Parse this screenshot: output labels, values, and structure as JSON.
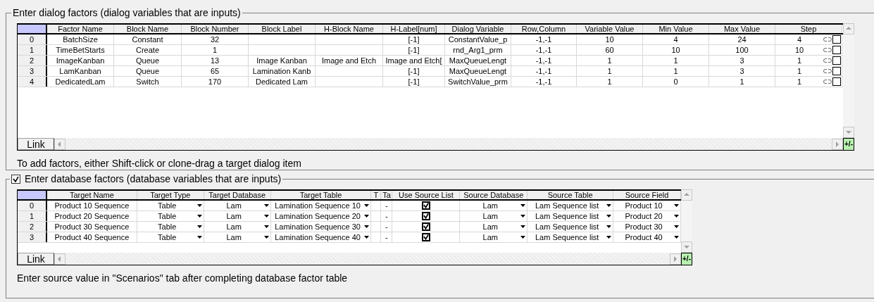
{
  "dialog_factors": {
    "title": "Enter dialog factors (dialog variables that are inputs)",
    "columns": [
      "Factor Name",
      "Block Name",
      "Block Number",
      "Block Label",
      "H-Block Name",
      "H-Label[num]",
      "Dialog Variable",
      "Row,Column",
      "Variable Value",
      "Min Value",
      "Max Value",
      "Step"
    ],
    "rows": [
      {
        "index": "0",
        "cells": [
          "BatchSize",
          "Constant",
          "32",
          "",
          "",
          "[-1]",
          "ConstantValue_p",
          "-1,-1",
          "10",
          "4",
          "24",
          "4"
        ],
        "checked": false
      },
      {
        "index": "1",
        "cells": [
          "TimeBetStarts",
          "Create",
          "1",
          "",
          "",
          "[-1]",
          "rnd_Arg1_prm",
          "-1,-1",
          "60",
          "10",
          "100",
          "10"
        ],
        "checked": false
      },
      {
        "index": "2",
        "cells": [
          "ImageKanban",
          "Queue",
          "13",
          "Image Kanban",
          "Image and Etch",
          "Image and Etch[",
          "MaxQueueLengt",
          "-1,-1",
          "1",
          "1",
          "3",
          "1"
        ],
        "checked": false
      },
      {
        "index": "3",
        "cells": [
          "LamKanban",
          "Queue",
          "65",
          "Lamination Kanb",
          "",
          "[-1]",
          "MaxQueueLengt",
          "-1,-1",
          "1",
          "1",
          "3",
          "1"
        ],
        "checked": false
      },
      {
        "index": "4",
        "cells": [
          "DedicatedLam",
          "Switch",
          "170",
          "Dedicated Lam",
          "",
          "[-1]",
          "SwitchValue_prm",
          "-1,-1",
          "1",
          "0",
          "1",
          "1"
        ],
        "checked": false
      }
    ],
    "link_button": "Link",
    "add_remove_button": "+/-",
    "hint": "To add factors, either Shift-click or clone-drag a target dialog item"
  },
  "database_factors": {
    "title": "Enter database factors (database variables that are inputs)",
    "enabled": true,
    "columns": [
      {
        "label": "Target Name",
        "kind": "text"
      },
      {
        "label": "Target Type",
        "kind": "dropdown"
      },
      {
        "label": "Target Database",
        "kind": "dropdown"
      },
      {
        "label": "Target Table",
        "kind": "dropdown"
      },
      {
        "label": "T",
        "kind": "text"
      },
      {
        "label": "Ta",
        "kind": "text"
      },
      {
        "label": "Use Source List",
        "kind": "checkbox"
      },
      {
        "label": "Source Database",
        "kind": "dropdown"
      },
      {
        "label": "Source Table",
        "kind": "dropdown"
      },
      {
        "label": "Source Field",
        "kind": "dropdown"
      }
    ],
    "rows": [
      {
        "index": "0",
        "cells": [
          "Product 10 Sequence",
          "Table",
          "Lam",
          "Lamination Sequence 10",
          "",
          "-",
          true,
          "Lam",
          "Lam Sequence list",
          "Product 10"
        ]
      },
      {
        "index": "1",
        "cells": [
          "Product 20 Sequence",
          "Table",
          "Lam",
          "Lamination Sequence 20",
          "",
          "-",
          true,
          "Lam",
          "Lam Sequence list",
          "Product 20"
        ]
      },
      {
        "index": "2",
        "cells": [
          "Product 30 Sequence",
          "Table",
          "Lam",
          "Lamination Sequence 30",
          "",
          "-",
          true,
          "Lam",
          "Lam Sequence list",
          "Product 30"
        ]
      },
      {
        "index": "3",
        "cells": [
          "Product 40 Sequence",
          "Table",
          "Lam",
          "Lamination Sequence 40",
          "",
          "-",
          true,
          "Lam",
          "Lam Sequence list",
          "Product 40"
        ]
      }
    ],
    "link_button": "Link",
    "add_remove_button": "+/-",
    "hint": "Enter source value in \"Scenarios\" tab after completing database factor table"
  }
}
